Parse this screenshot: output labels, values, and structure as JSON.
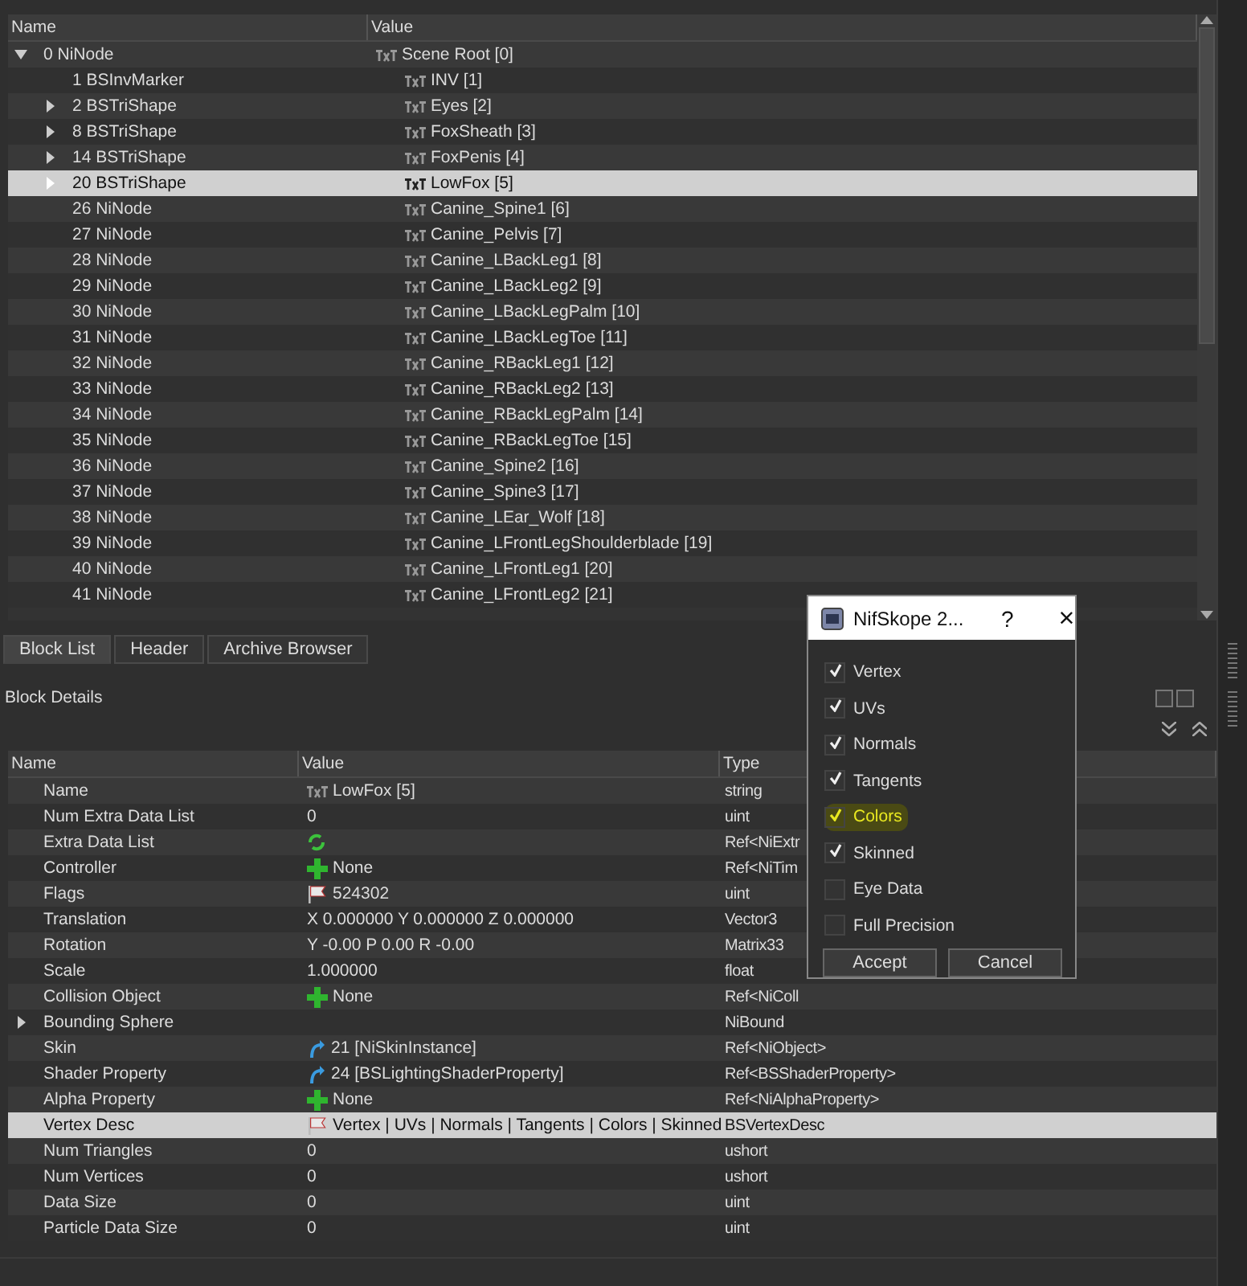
{
  "block_list": {
    "columns": [
      "Name",
      "Value"
    ],
    "tree": [
      {
        "name": "0 NiNode",
        "value": "Scene Root [0]",
        "expandable": true,
        "expanded": true,
        "selected": false,
        "children": [
          {
            "name": "1 BSInvMarker",
            "value": "INV [1]",
            "expandable": false,
            "expanded": false,
            "selected": false
          },
          {
            "name": "2 BSTriShape",
            "value": "Eyes [2]",
            "expandable": true,
            "expanded": false,
            "selected": false
          },
          {
            "name": "8 BSTriShape",
            "value": "FoxSheath [3]",
            "expandable": true,
            "expanded": false,
            "selected": false
          },
          {
            "name": "14 BSTriShape",
            "value": "FoxPenis [4]",
            "expandable": true,
            "expanded": false,
            "selected": false
          },
          {
            "name": "20 BSTriShape",
            "value": "LowFox [5]",
            "expandable": true,
            "expanded": false,
            "selected": true
          },
          {
            "name": "26 NiNode",
            "value": "Canine_Spine1 [6]",
            "expandable": false,
            "expanded": false,
            "selected": false
          },
          {
            "name": "27 NiNode",
            "value": "Canine_Pelvis [7]",
            "expandable": false,
            "expanded": false,
            "selected": false
          },
          {
            "name": "28 NiNode",
            "value": "Canine_LBackLeg1 [8]",
            "expandable": false,
            "expanded": false,
            "selected": false
          },
          {
            "name": "29 NiNode",
            "value": "Canine_LBackLeg2 [9]",
            "expandable": false,
            "expanded": false,
            "selected": false
          },
          {
            "name": "30 NiNode",
            "value": "Canine_LBackLegPalm [10]",
            "expandable": false,
            "expanded": false,
            "selected": false
          },
          {
            "name": "31 NiNode",
            "value": "Canine_LBackLegToe [11]",
            "expandable": false,
            "expanded": false,
            "selected": false
          },
          {
            "name": "32 NiNode",
            "value": "Canine_RBackLeg1 [12]",
            "expandable": false,
            "expanded": false,
            "selected": false
          },
          {
            "name": "33 NiNode",
            "value": "Canine_RBackLeg2 [13]",
            "expandable": false,
            "expanded": false,
            "selected": false
          },
          {
            "name": "34 NiNode",
            "value": "Canine_RBackLegPalm [14]",
            "expandable": false,
            "expanded": false,
            "selected": false
          },
          {
            "name": "35 NiNode",
            "value": "Canine_RBackLegToe [15]",
            "expandable": false,
            "expanded": false,
            "selected": false
          },
          {
            "name": "36 NiNode",
            "value": "Canine_Spine2 [16]",
            "expandable": false,
            "expanded": false,
            "selected": false
          },
          {
            "name": "37 NiNode",
            "value": "Canine_Spine3 [17]",
            "expandable": false,
            "expanded": false,
            "selected": false
          },
          {
            "name": "38 NiNode",
            "value": "Canine_LEar_Wolf [18]",
            "expandable": false,
            "expanded": false,
            "selected": false
          },
          {
            "name": "39 NiNode",
            "value": "Canine_LFrontLegShoulderblade [19]",
            "expandable": false,
            "expanded": false,
            "selected": false
          },
          {
            "name": "40 NiNode",
            "value": "Canine_LFrontLeg1 [20]",
            "expandable": false,
            "expanded": false,
            "selected": false
          },
          {
            "name": "41 NiNode",
            "value": "Canine_LFrontLeg2 [21]",
            "expandable": false,
            "expanded": false,
            "selected": false
          }
        ]
      }
    ]
  },
  "tabs": [
    {
      "label": "Block List",
      "selected": true
    },
    {
      "label": "Header",
      "selected": false
    },
    {
      "label": "Archive Browser",
      "selected": false
    }
  ],
  "block_details": {
    "title": "Block Details",
    "columns": [
      "Name",
      "Value",
      "Type"
    ],
    "rows": [
      {
        "name": "Name",
        "kind": "txt",
        "value": "LowFox [5]",
        "type": "string",
        "expandable": false,
        "selected": false
      },
      {
        "name": "Num Extra Data List",
        "kind": "none",
        "value": "0",
        "type": "uint",
        "expandable": false,
        "selected": false
      },
      {
        "name": "Extra Data List",
        "kind": "refresh",
        "type": "Ref<NiExtr",
        "expandable": false,
        "selected": false
      },
      {
        "name": "Controller",
        "kind": "plus",
        "value": "None",
        "type": "Ref<NiTim",
        "expandable": false,
        "selected": false
      },
      {
        "name": "Flags",
        "kind": "flag",
        "value": "524302",
        "type": "uint",
        "expandable": false,
        "selected": false
      },
      {
        "name": "Translation",
        "kind": "none",
        "value": "X 0.000000 Y 0.000000 Z 0.000000",
        "type": "Vector3",
        "expandable": false,
        "selected": false
      },
      {
        "name": "Rotation",
        "kind": "none",
        "value": "Y -0.00 P 0.00 R -0.00",
        "type": "Matrix33",
        "expandable": false,
        "selected": false
      },
      {
        "name": "Scale",
        "kind": "none",
        "value": "1.000000",
        "type": "float",
        "expandable": false,
        "selected": false
      },
      {
        "name": "Collision Object",
        "kind": "plus",
        "value": "None",
        "type": "Ref<NiColl",
        "expandable": false,
        "selected": false
      },
      {
        "name": "Bounding Sphere",
        "kind": "none",
        "type": "NiBound",
        "expandable": true,
        "selected": false
      },
      {
        "name": "Skin",
        "kind": "link",
        "value": "21 [NiSkinInstance]",
        "type": "Ref<NiObject>",
        "expandable": false,
        "selected": false
      },
      {
        "name": "Shader Property",
        "kind": "link",
        "value": "24 [BSLightingShaderProperty]",
        "type": "Ref<BSShaderProperty>",
        "expandable": false,
        "selected": false
      },
      {
        "name": "Alpha Property",
        "kind": "plus",
        "value": "None",
        "type": "Ref<NiAlphaProperty>",
        "expandable": false,
        "selected": false
      },
      {
        "name": "Vertex Desc",
        "kind": "flag",
        "value": "Vertex | UVs | Normals | Tangents | Colors | Skinned",
        "type": "BSVertexDesc",
        "expandable": false,
        "selected": true
      },
      {
        "name": "Num Triangles",
        "kind": "none",
        "value": "0",
        "type": "ushort",
        "expandable": false,
        "selected": false
      },
      {
        "name": "Num Vertices",
        "kind": "none",
        "value": "0",
        "type": "ushort",
        "expandable": false,
        "selected": false
      },
      {
        "name": "Data Size",
        "kind": "none",
        "value": "0",
        "type": "uint",
        "expandable": false,
        "selected": false
      },
      {
        "name": "Particle Data Size",
        "kind": "none",
        "value": "0",
        "type": "uint",
        "expandable": false,
        "selected": false
      }
    ]
  },
  "dialog": {
    "title": "NifSkope 2...",
    "help": "?",
    "close": "×",
    "options": [
      {
        "label": "Vertex",
        "checked": true,
        "highlighted": false
      },
      {
        "label": "UVs",
        "checked": true,
        "highlighted": false
      },
      {
        "label": "Normals",
        "checked": true,
        "highlighted": false
      },
      {
        "label": "Tangents",
        "checked": true,
        "highlighted": false
      },
      {
        "label": "Colors",
        "checked": true,
        "highlighted": true
      },
      {
        "label": "Skinned",
        "checked": true,
        "highlighted": false
      },
      {
        "label": "Eye Data",
        "checked": false,
        "highlighted": false
      },
      {
        "label": "Full Precision",
        "checked": false,
        "highlighted": false
      }
    ],
    "buttons": [
      "Accept",
      "Cancel"
    ]
  }
}
